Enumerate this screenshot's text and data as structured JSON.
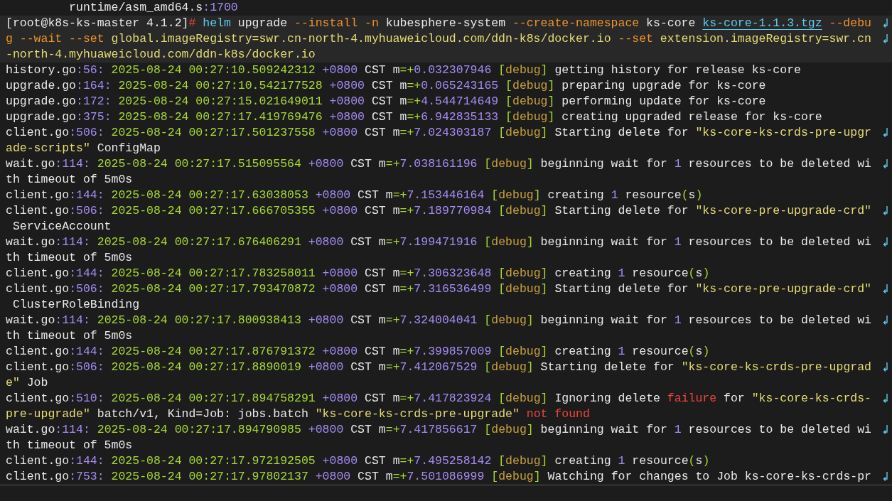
{
  "terminal": {
    "lines": [
      {
        "highlighted": false,
        "wrapped": false,
        "segments": [
          {
            "kind": "plain",
            "text": "         runtime/asm_amd64.s"
          },
          {
            "kind": "num",
            "text": ":1700"
          }
        ]
      },
      {
        "highlighted": true,
        "wrapped": true,
        "segments": [
          {
            "kind": "plain",
            "text": "[root@k8s-ks-master 4.1.2]"
          },
          {
            "kind": "err",
            "text": "#"
          },
          {
            "kind": "cmd",
            "text": " helm"
          },
          {
            "kind": "plain",
            "text": " upgrade "
          },
          {
            "kind": "flag",
            "text": "--install -n"
          },
          {
            "kind": "plain",
            "text": " kubesphere-system "
          },
          {
            "kind": "flag",
            "text": "--create-namespace"
          },
          {
            "kind": "plain",
            "text": " ks-core "
          },
          {
            "kind": "link",
            "text": "ks-core-1.1.3.tgz"
          },
          {
            "kind": "flag",
            "text": " --debu"
          }
        ]
      },
      {
        "highlighted": true,
        "wrapped": true,
        "segments": [
          {
            "kind": "flag",
            "text": "g --wait --set"
          },
          {
            "kind": "str",
            "text": " global.imageRegistry=swr.cn-north-4.myhuaweicloud.com/ddn-k8s/docker.io "
          },
          {
            "kind": "flag",
            "text": "--set"
          },
          {
            "kind": "str",
            "text": " extension.imageRegistry=swr.cn"
          }
        ]
      },
      {
        "highlighted": true,
        "wrapped": false,
        "segments": [
          {
            "kind": "str",
            "text": "-north-4.myhuaweicloud.com/ddn-k8s/docker.io"
          }
        ]
      },
      {
        "highlighted": false,
        "wrapped": false,
        "segments": [
          {
            "kind": "plain",
            "text": "history.go"
          },
          {
            "kind": "num",
            "text": ":56:"
          },
          {
            "kind": "time",
            "text": " 2025-08-24 00:27:10.509242312"
          },
          {
            "kind": "num",
            "text": " +0800"
          },
          {
            "kind": "plain",
            "text": " CST m"
          },
          {
            "kind": "punct",
            "text": "=+"
          },
          {
            "kind": "num",
            "text": "0.032307946"
          },
          {
            "kind": "punct",
            "text": " ["
          },
          {
            "kind": "level",
            "text": "debug"
          },
          {
            "kind": "punct",
            "text": "]"
          },
          {
            "kind": "plain",
            "text": " getting history for release ks-core"
          }
        ]
      },
      {
        "highlighted": false,
        "wrapped": false,
        "segments": [
          {
            "kind": "plain",
            "text": "upgrade.go"
          },
          {
            "kind": "num",
            "text": ":164:"
          },
          {
            "kind": "time",
            "text": " 2025-08-24 00:27:10.542177528"
          },
          {
            "kind": "num",
            "text": " +0800"
          },
          {
            "kind": "plain",
            "text": " CST m"
          },
          {
            "kind": "punct",
            "text": "=+"
          },
          {
            "kind": "num",
            "text": "0.065243165"
          },
          {
            "kind": "punct",
            "text": " ["
          },
          {
            "kind": "level",
            "text": "debug"
          },
          {
            "kind": "punct",
            "text": "]"
          },
          {
            "kind": "plain",
            "text": " preparing upgrade for ks-core"
          }
        ]
      },
      {
        "highlighted": false,
        "wrapped": false,
        "segments": [
          {
            "kind": "plain",
            "text": "upgrade.go"
          },
          {
            "kind": "num",
            "text": ":172:"
          },
          {
            "kind": "time",
            "text": " 2025-08-24 00:27:15.021649011"
          },
          {
            "kind": "num",
            "text": " +0800"
          },
          {
            "kind": "plain",
            "text": " CST m"
          },
          {
            "kind": "punct",
            "text": "=+"
          },
          {
            "kind": "num",
            "text": "4.544714649"
          },
          {
            "kind": "punct",
            "text": " ["
          },
          {
            "kind": "level",
            "text": "debug"
          },
          {
            "kind": "punct",
            "text": "]"
          },
          {
            "kind": "plain",
            "text": " performing update for ks-core"
          }
        ]
      },
      {
        "highlighted": false,
        "wrapped": false,
        "segments": [
          {
            "kind": "plain",
            "text": "upgrade.go"
          },
          {
            "kind": "num",
            "text": ":375:"
          },
          {
            "kind": "time",
            "text": " 2025-08-24 00:27:17.419769476"
          },
          {
            "kind": "num",
            "text": " +0800"
          },
          {
            "kind": "plain",
            "text": " CST m"
          },
          {
            "kind": "punct",
            "text": "=+"
          },
          {
            "kind": "num",
            "text": "6.942835133"
          },
          {
            "kind": "punct",
            "text": " ["
          },
          {
            "kind": "level",
            "text": "debug"
          },
          {
            "kind": "punct",
            "text": "]"
          },
          {
            "kind": "plain",
            "text": " creating upgraded release for ks-core"
          }
        ]
      },
      {
        "highlighted": false,
        "wrapped": true,
        "segments": [
          {
            "kind": "plain",
            "text": "client.go"
          },
          {
            "kind": "num",
            "text": ":506:"
          },
          {
            "kind": "time",
            "text": " 2025-08-24 00:27:17.501237558"
          },
          {
            "kind": "num",
            "text": " +0800"
          },
          {
            "kind": "plain",
            "text": " CST m"
          },
          {
            "kind": "punct",
            "text": "=+"
          },
          {
            "kind": "num",
            "text": "7.024303187"
          },
          {
            "kind": "punct",
            "text": " ["
          },
          {
            "kind": "level",
            "text": "debug"
          },
          {
            "kind": "punct",
            "text": "]"
          },
          {
            "kind": "plain",
            "text": " Starting delete for "
          },
          {
            "kind": "str",
            "text": "\"ks-core-ks-crds-pre-upgr"
          }
        ]
      },
      {
        "highlighted": false,
        "wrapped": false,
        "segments": [
          {
            "kind": "str",
            "text": "ade-scripts\""
          },
          {
            "kind": "plain",
            "text": " ConfigMap"
          }
        ]
      },
      {
        "highlighted": false,
        "wrapped": true,
        "segments": [
          {
            "kind": "plain",
            "text": "wait.go"
          },
          {
            "kind": "num",
            "text": ":114:"
          },
          {
            "kind": "time",
            "text": " 2025-08-24 00:27:17.515095564"
          },
          {
            "kind": "num",
            "text": " +0800"
          },
          {
            "kind": "plain",
            "text": " CST m"
          },
          {
            "kind": "punct",
            "text": "=+"
          },
          {
            "kind": "num",
            "text": "7.038161196"
          },
          {
            "kind": "punct",
            "text": " ["
          },
          {
            "kind": "level",
            "text": "debug"
          },
          {
            "kind": "punct",
            "text": "]"
          },
          {
            "kind": "plain",
            "text": " beginning wait for "
          },
          {
            "kind": "num",
            "text": "1"
          },
          {
            "kind": "plain",
            "text": " resources to be deleted wi"
          }
        ]
      },
      {
        "highlighted": false,
        "wrapped": false,
        "segments": [
          {
            "kind": "plain",
            "text": "th timeout of 5m0s"
          }
        ]
      },
      {
        "highlighted": false,
        "wrapped": false,
        "segments": [
          {
            "kind": "plain",
            "text": "client.go"
          },
          {
            "kind": "num",
            "text": ":144:"
          },
          {
            "kind": "time",
            "text": " 2025-08-24 00:27:17.63038053"
          },
          {
            "kind": "num",
            "text": " +0800"
          },
          {
            "kind": "plain",
            "text": " CST m"
          },
          {
            "kind": "punct",
            "text": "=+"
          },
          {
            "kind": "num",
            "text": "7.153446164"
          },
          {
            "kind": "punct",
            "text": " ["
          },
          {
            "kind": "level",
            "text": "debug"
          },
          {
            "kind": "punct",
            "text": "]"
          },
          {
            "kind": "plain",
            "text": " creating "
          },
          {
            "kind": "num",
            "text": "1"
          },
          {
            "kind": "plain",
            "text": " resource"
          },
          {
            "kind": "punct",
            "text": "("
          },
          {
            "kind": "plain",
            "text": "s"
          },
          {
            "kind": "punct",
            "text": ")"
          }
        ]
      },
      {
        "highlighted": false,
        "wrapped": true,
        "segments": [
          {
            "kind": "plain",
            "text": "client.go"
          },
          {
            "kind": "num",
            "text": ":506:"
          },
          {
            "kind": "time",
            "text": " 2025-08-24 00:27:17.666705355"
          },
          {
            "kind": "num",
            "text": " +0800"
          },
          {
            "kind": "plain",
            "text": " CST m"
          },
          {
            "kind": "punct",
            "text": "=+"
          },
          {
            "kind": "num",
            "text": "7.189770984"
          },
          {
            "kind": "punct",
            "text": " ["
          },
          {
            "kind": "level",
            "text": "debug"
          },
          {
            "kind": "punct",
            "text": "]"
          },
          {
            "kind": "plain",
            "text": " Starting delete for "
          },
          {
            "kind": "str",
            "text": "\"ks-core-pre-upgrade-crd\""
          }
        ]
      },
      {
        "highlighted": false,
        "wrapped": false,
        "segments": [
          {
            "kind": "plain",
            "text": " ServiceAccount"
          }
        ]
      },
      {
        "highlighted": false,
        "wrapped": true,
        "segments": [
          {
            "kind": "plain",
            "text": "wait.go"
          },
          {
            "kind": "num",
            "text": ":114:"
          },
          {
            "kind": "time",
            "text": " 2025-08-24 00:27:17.676406291"
          },
          {
            "kind": "num",
            "text": " +0800"
          },
          {
            "kind": "plain",
            "text": " CST m"
          },
          {
            "kind": "punct",
            "text": "=+"
          },
          {
            "kind": "num",
            "text": "7.199471916"
          },
          {
            "kind": "punct",
            "text": " ["
          },
          {
            "kind": "level",
            "text": "debug"
          },
          {
            "kind": "punct",
            "text": "]"
          },
          {
            "kind": "plain",
            "text": " beginning wait for "
          },
          {
            "kind": "num",
            "text": "1"
          },
          {
            "kind": "plain",
            "text": " resources to be deleted wi"
          }
        ]
      },
      {
        "highlighted": false,
        "wrapped": false,
        "segments": [
          {
            "kind": "plain",
            "text": "th timeout of 5m0s"
          }
        ]
      },
      {
        "highlighted": false,
        "wrapped": false,
        "segments": [
          {
            "kind": "plain",
            "text": "client.go"
          },
          {
            "kind": "num",
            "text": ":144:"
          },
          {
            "kind": "time",
            "text": " 2025-08-24 00:27:17.783258011"
          },
          {
            "kind": "num",
            "text": " +0800"
          },
          {
            "kind": "plain",
            "text": " CST m"
          },
          {
            "kind": "punct",
            "text": "=+"
          },
          {
            "kind": "num",
            "text": "7.306323648"
          },
          {
            "kind": "punct",
            "text": " ["
          },
          {
            "kind": "level",
            "text": "debug"
          },
          {
            "kind": "punct",
            "text": "]"
          },
          {
            "kind": "plain",
            "text": " creating "
          },
          {
            "kind": "num",
            "text": "1"
          },
          {
            "kind": "plain",
            "text": " resource"
          },
          {
            "kind": "punct",
            "text": "("
          },
          {
            "kind": "plain",
            "text": "s"
          },
          {
            "kind": "punct",
            "text": ")"
          }
        ]
      },
      {
        "highlighted": false,
        "wrapped": true,
        "segments": [
          {
            "kind": "plain",
            "text": "client.go"
          },
          {
            "kind": "num",
            "text": ":506:"
          },
          {
            "kind": "time",
            "text": " 2025-08-24 00:27:17.793470872"
          },
          {
            "kind": "num",
            "text": " +0800"
          },
          {
            "kind": "plain",
            "text": " CST m"
          },
          {
            "kind": "punct",
            "text": "=+"
          },
          {
            "kind": "num",
            "text": "7.316536499"
          },
          {
            "kind": "punct",
            "text": " ["
          },
          {
            "kind": "level",
            "text": "debug"
          },
          {
            "kind": "punct",
            "text": "]"
          },
          {
            "kind": "plain",
            "text": " Starting delete for "
          },
          {
            "kind": "str",
            "text": "\"ks-core-pre-upgrade-crd\""
          }
        ]
      },
      {
        "highlighted": false,
        "wrapped": false,
        "segments": [
          {
            "kind": "plain",
            "text": " ClusterRoleBinding"
          }
        ]
      },
      {
        "highlighted": false,
        "wrapped": true,
        "segments": [
          {
            "kind": "plain",
            "text": "wait.go"
          },
          {
            "kind": "num",
            "text": ":114:"
          },
          {
            "kind": "time",
            "text": " 2025-08-24 00:27:17.800938413"
          },
          {
            "kind": "num",
            "text": " +0800"
          },
          {
            "kind": "plain",
            "text": " CST m"
          },
          {
            "kind": "punct",
            "text": "=+"
          },
          {
            "kind": "num",
            "text": "7.324004041"
          },
          {
            "kind": "punct",
            "text": " ["
          },
          {
            "kind": "level",
            "text": "debug"
          },
          {
            "kind": "punct",
            "text": "]"
          },
          {
            "kind": "plain",
            "text": " beginning wait for "
          },
          {
            "kind": "num",
            "text": "1"
          },
          {
            "kind": "plain",
            "text": " resources to be deleted wi"
          }
        ]
      },
      {
        "highlighted": false,
        "wrapped": false,
        "segments": [
          {
            "kind": "plain",
            "text": "th timeout of 5m0s"
          }
        ]
      },
      {
        "highlighted": false,
        "wrapped": false,
        "segments": [
          {
            "kind": "plain",
            "text": "client.go"
          },
          {
            "kind": "num",
            "text": ":144:"
          },
          {
            "kind": "time",
            "text": " 2025-08-24 00:27:17.876791372"
          },
          {
            "kind": "num",
            "text": " +0800"
          },
          {
            "kind": "plain",
            "text": " CST m"
          },
          {
            "kind": "punct",
            "text": "=+"
          },
          {
            "kind": "num",
            "text": "7.399857009"
          },
          {
            "kind": "punct",
            "text": " ["
          },
          {
            "kind": "level",
            "text": "debug"
          },
          {
            "kind": "punct",
            "text": "]"
          },
          {
            "kind": "plain",
            "text": " creating "
          },
          {
            "kind": "num",
            "text": "1"
          },
          {
            "kind": "plain",
            "text": " resource"
          },
          {
            "kind": "punct",
            "text": "("
          },
          {
            "kind": "plain",
            "text": "s"
          },
          {
            "kind": "punct",
            "text": ")"
          }
        ]
      },
      {
        "highlighted": false,
        "wrapped": true,
        "segments": [
          {
            "kind": "plain",
            "text": "client.go"
          },
          {
            "kind": "num",
            "text": ":506:"
          },
          {
            "kind": "time",
            "text": " 2025-08-24 00:27:17.8890019"
          },
          {
            "kind": "num",
            "text": " +0800"
          },
          {
            "kind": "plain",
            "text": " CST m"
          },
          {
            "kind": "punct",
            "text": "=+"
          },
          {
            "kind": "num",
            "text": "7.412067529"
          },
          {
            "kind": "punct",
            "text": " ["
          },
          {
            "kind": "level",
            "text": "debug"
          },
          {
            "kind": "punct",
            "text": "]"
          },
          {
            "kind": "plain",
            "text": " Starting delete for "
          },
          {
            "kind": "str",
            "text": "\"ks-core-ks-crds-pre-upgrad"
          }
        ]
      },
      {
        "highlighted": false,
        "wrapped": false,
        "segments": [
          {
            "kind": "str",
            "text": "e\""
          },
          {
            "kind": "plain",
            "text": " Job"
          }
        ]
      },
      {
        "highlighted": false,
        "wrapped": true,
        "segments": [
          {
            "kind": "plain",
            "text": "client.go"
          },
          {
            "kind": "num",
            "text": ":510:"
          },
          {
            "kind": "time",
            "text": " 2025-08-24 00:27:17.894758291"
          },
          {
            "kind": "num",
            "text": " +0800"
          },
          {
            "kind": "plain",
            "text": " CST m"
          },
          {
            "kind": "punct",
            "text": "=+"
          },
          {
            "kind": "num",
            "text": "7.417823924"
          },
          {
            "kind": "punct",
            "text": " ["
          },
          {
            "kind": "level",
            "text": "debug"
          },
          {
            "kind": "punct",
            "text": "]"
          },
          {
            "kind": "plain",
            "text": " Ignoring delete "
          },
          {
            "kind": "err",
            "text": "failure"
          },
          {
            "kind": "plain",
            "text": " for "
          },
          {
            "kind": "str",
            "text": "\"ks-core-ks-crds-"
          }
        ]
      },
      {
        "highlighted": false,
        "wrapped": false,
        "segments": [
          {
            "kind": "str",
            "text": "pre-upgrade\""
          },
          {
            "kind": "plain",
            "text": " batch/v1, Kind=Job: jobs.batch "
          },
          {
            "kind": "str",
            "text": "\"ks-core-ks-crds-pre-upgrade\""
          },
          {
            "kind": "err",
            "text": " not found"
          }
        ]
      },
      {
        "highlighted": false,
        "wrapped": true,
        "segments": [
          {
            "kind": "plain",
            "text": "wait.go"
          },
          {
            "kind": "num",
            "text": ":114:"
          },
          {
            "kind": "time",
            "text": " 2025-08-24 00:27:17.894790985"
          },
          {
            "kind": "num",
            "text": " +0800"
          },
          {
            "kind": "plain",
            "text": " CST m"
          },
          {
            "kind": "punct",
            "text": "=+"
          },
          {
            "kind": "num",
            "text": "7.417856617"
          },
          {
            "kind": "punct",
            "text": " ["
          },
          {
            "kind": "level",
            "text": "debug"
          },
          {
            "kind": "punct",
            "text": "]"
          },
          {
            "kind": "plain",
            "text": " beginning wait for "
          },
          {
            "kind": "num",
            "text": "1"
          },
          {
            "kind": "plain",
            "text": " resources to be deleted wi"
          }
        ]
      },
      {
        "highlighted": false,
        "wrapped": false,
        "segments": [
          {
            "kind": "plain",
            "text": "th timeout of 5m0s"
          }
        ]
      },
      {
        "highlighted": false,
        "wrapped": false,
        "segments": [
          {
            "kind": "plain",
            "text": "client.go"
          },
          {
            "kind": "num",
            "text": ":144:"
          },
          {
            "kind": "time",
            "text": " 2025-08-24 00:27:17.972192505"
          },
          {
            "kind": "num",
            "text": " +0800"
          },
          {
            "kind": "plain",
            "text": " CST m"
          },
          {
            "kind": "punct",
            "text": "=+"
          },
          {
            "kind": "num",
            "text": "7.495258142"
          },
          {
            "kind": "punct",
            "text": " ["
          },
          {
            "kind": "level",
            "text": "debug"
          },
          {
            "kind": "punct",
            "text": "]"
          },
          {
            "kind": "plain",
            "text": " creating "
          },
          {
            "kind": "num",
            "text": "1"
          },
          {
            "kind": "plain",
            "text": " resource"
          },
          {
            "kind": "punct",
            "text": "("
          },
          {
            "kind": "plain",
            "text": "s"
          },
          {
            "kind": "punct",
            "text": ")"
          }
        ]
      },
      {
        "highlighted": false,
        "wrapped": true,
        "segments": [
          {
            "kind": "plain",
            "text": "client.go"
          },
          {
            "kind": "num",
            "text": ":753:"
          },
          {
            "kind": "time",
            "text": " 2025-08-24 00:27:17.97802137"
          },
          {
            "kind": "num",
            "text": " +0800"
          },
          {
            "kind": "plain",
            "text": " CST m"
          },
          {
            "kind": "punct",
            "text": "=+"
          },
          {
            "kind": "num",
            "text": "7.501086999"
          },
          {
            "kind": "punct",
            "text": " ["
          },
          {
            "kind": "level",
            "text": "debug"
          },
          {
            "kind": "punct",
            "text": "]"
          },
          {
            "kind": "plain",
            "text": " Watching for changes to Job ks-core-ks-crds-pr"
          }
        ]
      }
    ]
  }
}
